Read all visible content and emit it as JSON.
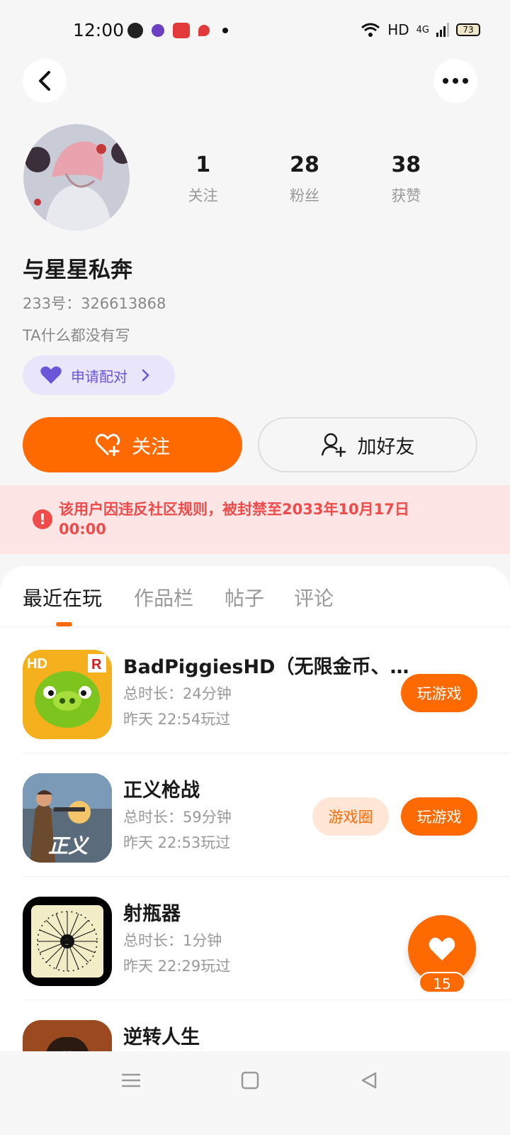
{
  "status_bar": {
    "time": "12:00",
    "network": "HD",
    "signal": "4G",
    "battery": "73",
    "left_icons": [
      "wechat-icon",
      "app-icon",
      "sohu-icon",
      "map-icon",
      "dot-icon"
    ]
  },
  "profile": {
    "stats": [
      {
        "num": "1",
        "label": "关注"
      },
      {
        "num": "28",
        "label": "粉丝"
      },
      {
        "num": "38",
        "label": "获赞"
      }
    ],
    "username": "与星星私奔",
    "uid": "233号：326613868",
    "bio": "TA什么都没有写",
    "pair_label": "申请配对",
    "follow_label": "关注",
    "add_friend_label": "加好友"
  },
  "ban_notice": {
    "text": "该用户因违反社区规则，被封禁至2033年10月17日 00:00"
  },
  "tabs": [
    "最近在玩",
    "作品栏",
    "帖子",
    "评论"
  ],
  "games": [
    {
      "title": "BadPiggiesHD（无限金币、…",
      "duration": "总时长：24分钟",
      "last_played": "昨天 22:54玩过",
      "play_label": "玩游戏"
    },
    {
      "title": "正义枪战",
      "duration": "总时长：59分钟",
      "last_played": "昨天 22:53玩过",
      "circle_label": "游戏圈",
      "play_label": "玩游戏"
    },
    {
      "title": "射瓶器",
      "duration": "总时长：1分钟",
      "last_played": "昨天 22:29玩过"
    },
    {
      "title": "逆转人生"
    }
  ],
  "like_count": "15",
  "colors": {
    "accent": "#ff6a00",
    "ban": "#ef4b4b",
    "pair": "#6b55d8"
  }
}
